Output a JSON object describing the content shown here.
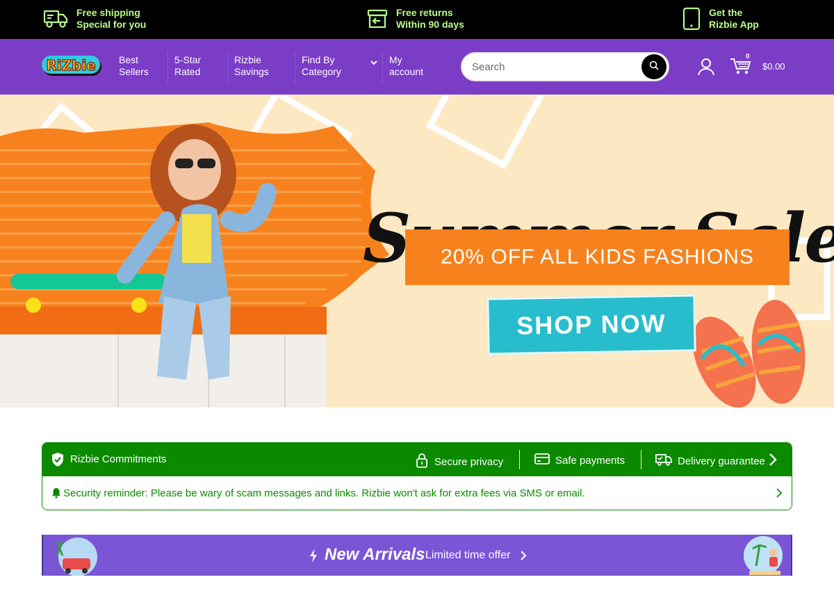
{
  "topbar": {
    "shipping": {
      "line1": "Free shipping",
      "line2": "Special for you",
      "icon": "truck-icon"
    },
    "returns": {
      "line1": "Free returns",
      "line2": "Within 90 days",
      "icon": "return-box-icon"
    },
    "app": {
      "line1": "Get the",
      "line2": "Rizbie App",
      "icon": "phone-icon"
    }
  },
  "nav": {
    "logo_text": "RiZbie",
    "links": [
      {
        "line1": "Best",
        "line2": "Sellers"
      },
      {
        "line1": "5-Star",
        "line2": "Rated"
      },
      {
        "line1": "Rizbie",
        "line2": "Savings"
      },
      {
        "line1": "Find By",
        "line2": "Category"
      },
      {
        "line1": "My",
        "line2": "account"
      }
    ],
    "search_placeholder": "Search",
    "cart_count": "0",
    "cart_total": "$0.00"
  },
  "hero": {
    "title": "Summer Sale.",
    "subtitle": "20% OFF ALL KIDS FASHIONS",
    "cta": "SHOP NOW"
  },
  "commitments": {
    "title": "Rizbie Commitments",
    "items": [
      {
        "label": "Secure privacy",
        "icon": "lock-icon"
      },
      {
        "label": "Safe payments",
        "icon": "card-icon"
      },
      {
        "label": "Delivery guarantee",
        "icon": "delivery-truck-icon"
      }
    ],
    "reminder": "Security reminder: Please be wary of scam messages and links. Rizbie won't ask for extra fees via SMS or email."
  },
  "arrivals": {
    "title": "New Arrivals",
    "subtitle": "Limited time offer"
  },
  "colors": {
    "topbar_bg": "#000000",
    "topbar_text": "#b8ff8a",
    "nav_bg": "#7b3cc6",
    "commit_green": "#0b8a00",
    "hero_orange": "#f7821d",
    "hero_cyan": "#27bdcc",
    "arrivals_bg": "#7a55d6"
  }
}
